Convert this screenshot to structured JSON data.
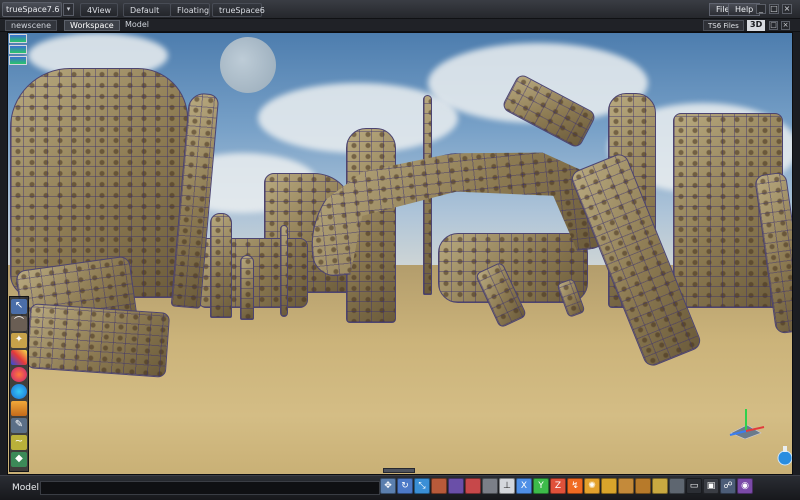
{
  "titlebar": {
    "app_title": "trueSpace7.6",
    "app_menu_glyph": "▾",
    "layouts": [
      "4View",
      "Default",
      "Floating",
      "trueSpace6"
    ],
    "menus": [
      "File",
      "Help"
    ],
    "window_controls": [
      "_",
      "□",
      "×"
    ]
  },
  "tabbar": {
    "tabs": [
      "newscene",
      "Workspace",
      "Model"
    ],
    "ts6_files": "TS6 Files",
    "view_mode": "3D",
    "window_controls": [
      "□",
      "×"
    ]
  },
  "statusbar": {
    "model_label": "Model"
  },
  "bottom_toolbar": {
    "axis_labels": [
      "X",
      "Y",
      "Z"
    ]
  },
  "colors": {
    "accent": "#3b6fd1",
    "mesh_wire": "#4c4470",
    "ground": "#cbb37a"
  },
  "icons": {
    "left_tools": [
      "select-icon",
      "lasso-icon",
      "light-icon",
      "material-icon",
      "paint-icon",
      "sphere-icon",
      "cube-icon",
      "wand-icon",
      "deform-icon",
      "render-icon"
    ],
    "bottom_tools": [
      "move-icon",
      "rotate-icon",
      "scale-icon",
      "object-icon",
      "object-icon",
      "object-icon",
      "object-icon",
      "axis-icon",
      "axis-x-icon",
      "axis-y-icon",
      "axis-z-icon",
      "snap-icon",
      "light-icon",
      "material-icon",
      "box-icon",
      "box-icon",
      "light-icon",
      "render-icon",
      "shell-icon",
      "window-icon",
      "network-icon",
      "camera-icon"
    ]
  }
}
